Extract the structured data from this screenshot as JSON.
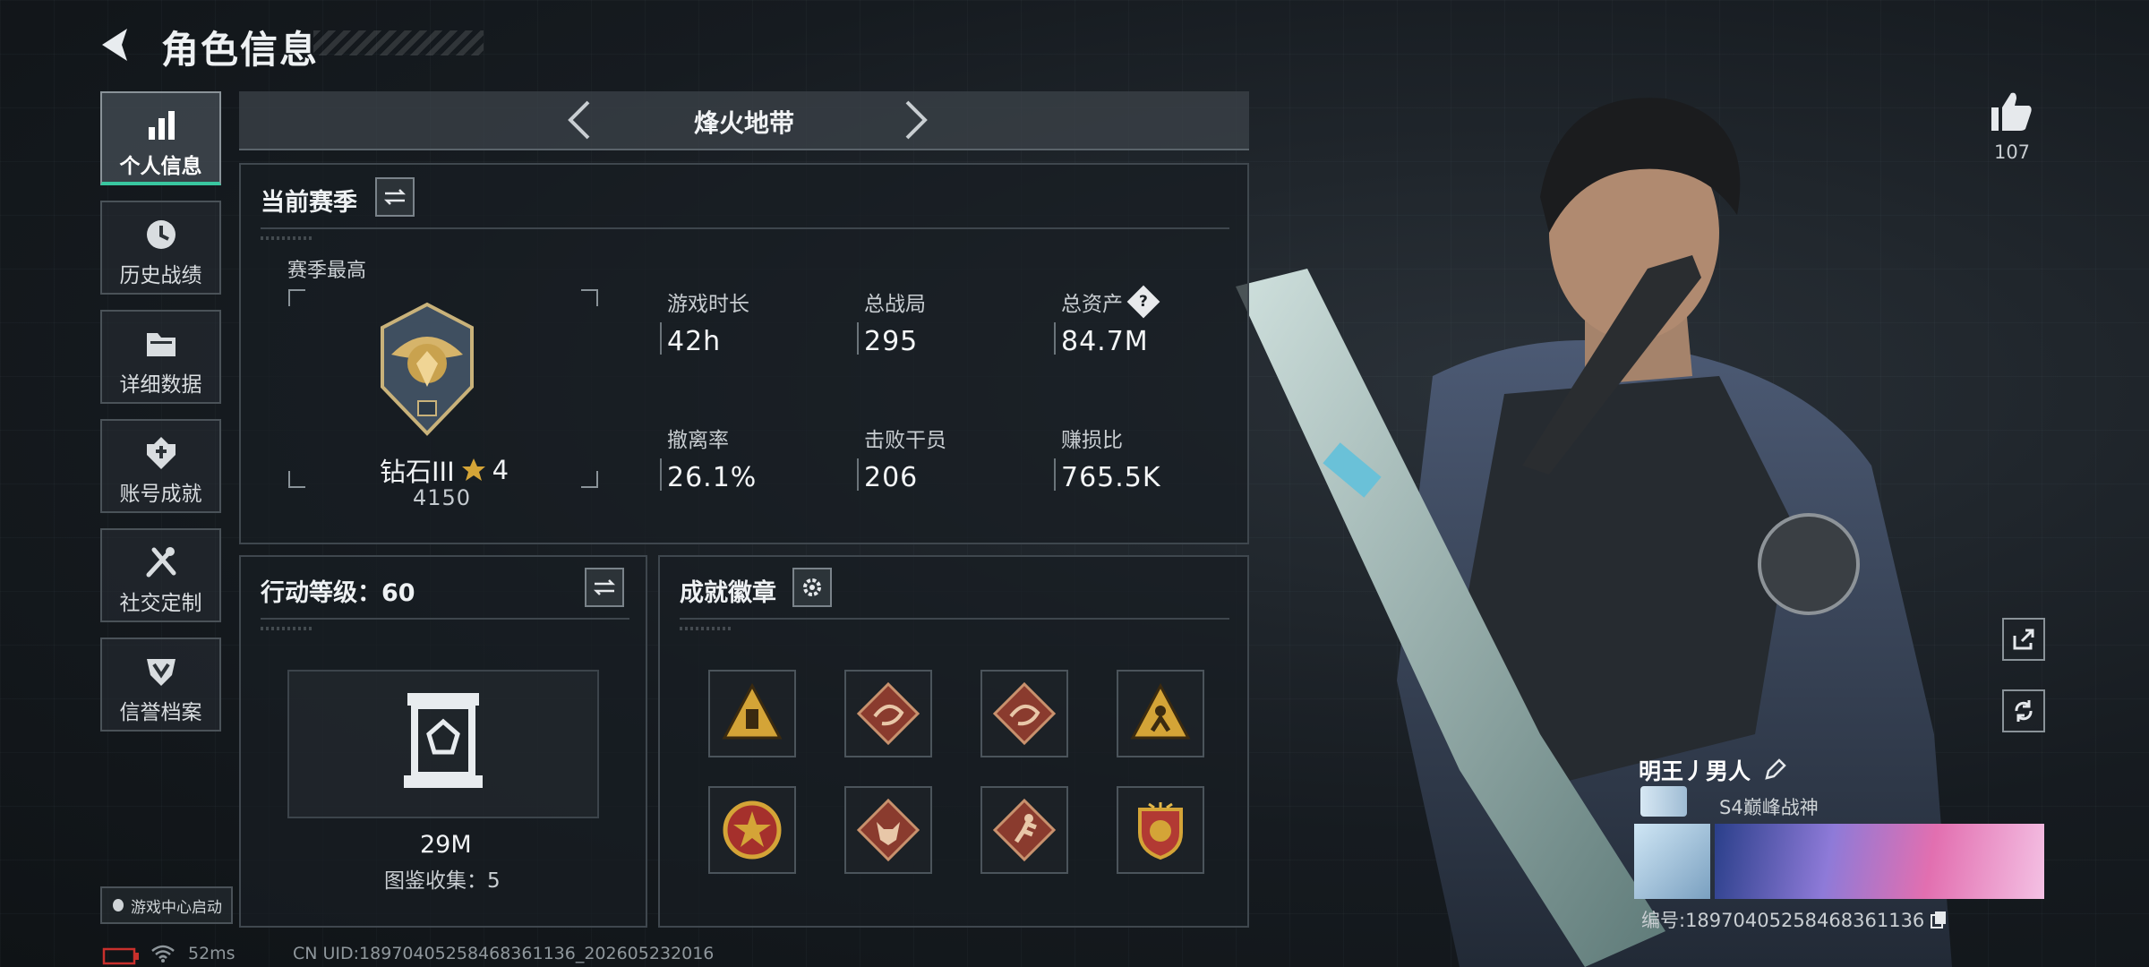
{
  "header": {
    "title": "角色信息"
  },
  "sidebar": {
    "items": [
      {
        "label": "个人信息",
        "icon": "bar-chart-icon",
        "active": true
      },
      {
        "label": "历史战绩",
        "icon": "clock-icon",
        "active": false
      },
      {
        "label": "详细数据",
        "icon": "folder-icon",
        "active": false
      },
      {
        "label": "账号成就",
        "icon": "achievement-icon",
        "active": false
      },
      {
        "label": "社交定制",
        "icon": "tools-icon",
        "active": false
      },
      {
        "label": "信誉档案",
        "icon": "shield-icon",
        "active": false
      }
    ],
    "launch_label": "游戏中心启动"
  },
  "mode": {
    "label": "烽火地带"
  },
  "season": {
    "title": "当前赛季",
    "best_label": "赛季最高",
    "rank_name": "钻石III",
    "rank_stars": "4",
    "rank_score": "4150",
    "stats": [
      {
        "label": "游戏时长",
        "value": "42h"
      },
      {
        "label": "总战局",
        "value": "295"
      },
      {
        "label": "总资产",
        "value": "84.7M",
        "help": "?"
      },
      {
        "label": "撤离率",
        "value": "26.1%"
      },
      {
        "label": "击败干员",
        "value": "206"
      },
      {
        "label": "赚损比",
        "value": "765.5K"
      }
    ]
  },
  "level": {
    "title": "行动等级：60",
    "value": "29M",
    "collection": "图鉴收集：5"
  },
  "badges": {
    "title": "成就徽章",
    "items": [
      {
        "icon": "triangle-badge-icon",
        "color": "#d4a437"
      },
      {
        "icon": "dragon-badge-icon",
        "color": "#8a3b2e"
      },
      {
        "icon": "dragon-badge-icon",
        "color": "#8a3b2e"
      },
      {
        "icon": "triangle-figure-badge-icon",
        "color": "#d4a437"
      },
      {
        "icon": "star-medal-badge-icon",
        "color": "#a5302c"
      },
      {
        "icon": "wolf-badge-icon",
        "color": "#8a3b2e"
      },
      {
        "icon": "runner-badge-icon",
        "color": "#8a3b2e"
      },
      {
        "icon": "crest-badge-icon",
        "color": "#b23a33"
      }
    ]
  },
  "profile": {
    "likes": "107",
    "name": "明王丿男人",
    "title": "S4巅峰战神",
    "id_text": "编号:18970405258468361136"
  },
  "status": {
    "ping": "52ms",
    "uid": "CN UID:18970405258468361136_202605232016"
  },
  "colors": {
    "accent": "#39c7a0",
    "gold": "#d4a437"
  }
}
